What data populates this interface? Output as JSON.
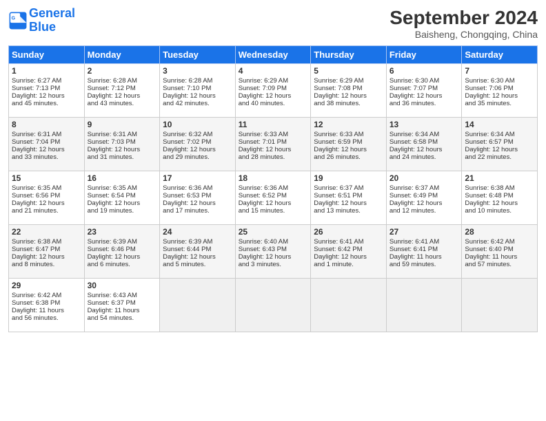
{
  "header": {
    "logo_line1": "General",
    "logo_line2": "Blue",
    "month": "September 2024",
    "location": "Baisheng, Chongqing, China"
  },
  "days_of_week": [
    "Sunday",
    "Monday",
    "Tuesday",
    "Wednesday",
    "Thursday",
    "Friday",
    "Saturday"
  ],
  "weeks": [
    [
      {
        "day": 1,
        "lines": [
          "Sunrise: 6:27 AM",
          "Sunset: 7:13 PM",
          "Daylight: 12 hours",
          "and 45 minutes."
        ]
      },
      {
        "day": 2,
        "lines": [
          "Sunrise: 6:28 AM",
          "Sunset: 7:12 PM",
          "Daylight: 12 hours",
          "and 43 minutes."
        ]
      },
      {
        "day": 3,
        "lines": [
          "Sunrise: 6:28 AM",
          "Sunset: 7:10 PM",
          "Daylight: 12 hours",
          "and 42 minutes."
        ]
      },
      {
        "day": 4,
        "lines": [
          "Sunrise: 6:29 AM",
          "Sunset: 7:09 PM",
          "Daylight: 12 hours",
          "and 40 minutes."
        ]
      },
      {
        "day": 5,
        "lines": [
          "Sunrise: 6:29 AM",
          "Sunset: 7:08 PM",
          "Daylight: 12 hours",
          "and 38 minutes."
        ]
      },
      {
        "day": 6,
        "lines": [
          "Sunrise: 6:30 AM",
          "Sunset: 7:07 PM",
          "Daylight: 12 hours",
          "and 36 minutes."
        ]
      },
      {
        "day": 7,
        "lines": [
          "Sunrise: 6:30 AM",
          "Sunset: 7:06 PM",
          "Daylight: 12 hours",
          "and 35 minutes."
        ]
      }
    ],
    [
      {
        "day": 8,
        "lines": [
          "Sunrise: 6:31 AM",
          "Sunset: 7:04 PM",
          "Daylight: 12 hours",
          "and 33 minutes."
        ]
      },
      {
        "day": 9,
        "lines": [
          "Sunrise: 6:31 AM",
          "Sunset: 7:03 PM",
          "Daylight: 12 hours",
          "and 31 minutes."
        ]
      },
      {
        "day": 10,
        "lines": [
          "Sunrise: 6:32 AM",
          "Sunset: 7:02 PM",
          "Daylight: 12 hours",
          "and 29 minutes."
        ]
      },
      {
        "day": 11,
        "lines": [
          "Sunrise: 6:33 AM",
          "Sunset: 7:01 PM",
          "Daylight: 12 hours",
          "and 28 minutes."
        ]
      },
      {
        "day": 12,
        "lines": [
          "Sunrise: 6:33 AM",
          "Sunset: 6:59 PM",
          "Daylight: 12 hours",
          "and 26 minutes."
        ]
      },
      {
        "day": 13,
        "lines": [
          "Sunrise: 6:34 AM",
          "Sunset: 6:58 PM",
          "Daylight: 12 hours",
          "and 24 minutes."
        ]
      },
      {
        "day": 14,
        "lines": [
          "Sunrise: 6:34 AM",
          "Sunset: 6:57 PM",
          "Daylight: 12 hours",
          "and 22 minutes."
        ]
      }
    ],
    [
      {
        "day": 15,
        "lines": [
          "Sunrise: 6:35 AM",
          "Sunset: 6:56 PM",
          "Daylight: 12 hours",
          "and 21 minutes."
        ]
      },
      {
        "day": 16,
        "lines": [
          "Sunrise: 6:35 AM",
          "Sunset: 6:54 PM",
          "Daylight: 12 hours",
          "and 19 minutes."
        ]
      },
      {
        "day": 17,
        "lines": [
          "Sunrise: 6:36 AM",
          "Sunset: 6:53 PM",
          "Daylight: 12 hours",
          "and 17 minutes."
        ]
      },
      {
        "day": 18,
        "lines": [
          "Sunrise: 6:36 AM",
          "Sunset: 6:52 PM",
          "Daylight: 12 hours",
          "and 15 minutes."
        ]
      },
      {
        "day": 19,
        "lines": [
          "Sunrise: 6:37 AM",
          "Sunset: 6:51 PM",
          "Daylight: 12 hours",
          "and 13 minutes."
        ]
      },
      {
        "day": 20,
        "lines": [
          "Sunrise: 6:37 AM",
          "Sunset: 6:49 PM",
          "Daylight: 12 hours",
          "and 12 minutes."
        ]
      },
      {
        "day": 21,
        "lines": [
          "Sunrise: 6:38 AM",
          "Sunset: 6:48 PM",
          "Daylight: 12 hours",
          "and 10 minutes."
        ]
      }
    ],
    [
      {
        "day": 22,
        "lines": [
          "Sunrise: 6:38 AM",
          "Sunset: 6:47 PM",
          "Daylight: 12 hours",
          "and 8 minutes."
        ]
      },
      {
        "day": 23,
        "lines": [
          "Sunrise: 6:39 AM",
          "Sunset: 6:46 PM",
          "Daylight: 12 hours",
          "and 6 minutes."
        ]
      },
      {
        "day": 24,
        "lines": [
          "Sunrise: 6:39 AM",
          "Sunset: 6:44 PM",
          "Daylight: 12 hours",
          "and 5 minutes."
        ]
      },
      {
        "day": 25,
        "lines": [
          "Sunrise: 6:40 AM",
          "Sunset: 6:43 PM",
          "Daylight: 12 hours",
          "and 3 minutes."
        ]
      },
      {
        "day": 26,
        "lines": [
          "Sunrise: 6:41 AM",
          "Sunset: 6:42 PM",
          "Daylight: 12 hours",
          "and 1 minute."
        ]
      },
      {
        "day": 27,
        "lines": [
          "Sunrise: 6:41 AM",
          "Sunset: 6:41 PM",
          "Daylight: 11 hours",
          "and 59 minutes."
        ]
      },
      {
        "day": 28,
        "lines": [
          "Sunrise: 6:42 AM",
          "Sunset: 6:40 PM",
          "Daylight: 11 hours",
          "and 57 minutes."
        ]
      }
    ],
    [
      {
        "day": 29,
        "lines": [
          "Sunrise: 6:42 AM",
          "Sunset: 6:38 PM",
          "Daylight: 11 hours",
          "and 56 minutes."
        ]
      },
      {
        "day": 30,
        "lines": [
          "Sunrise: 6:43 AM",
          "Sunset: 6:37 PM",
          "Daylight: 11 hours",
          "and 54 minutes."
        ]
      },
      null,
      null,
      null,
      null,
      null
    ]
  ]
}
